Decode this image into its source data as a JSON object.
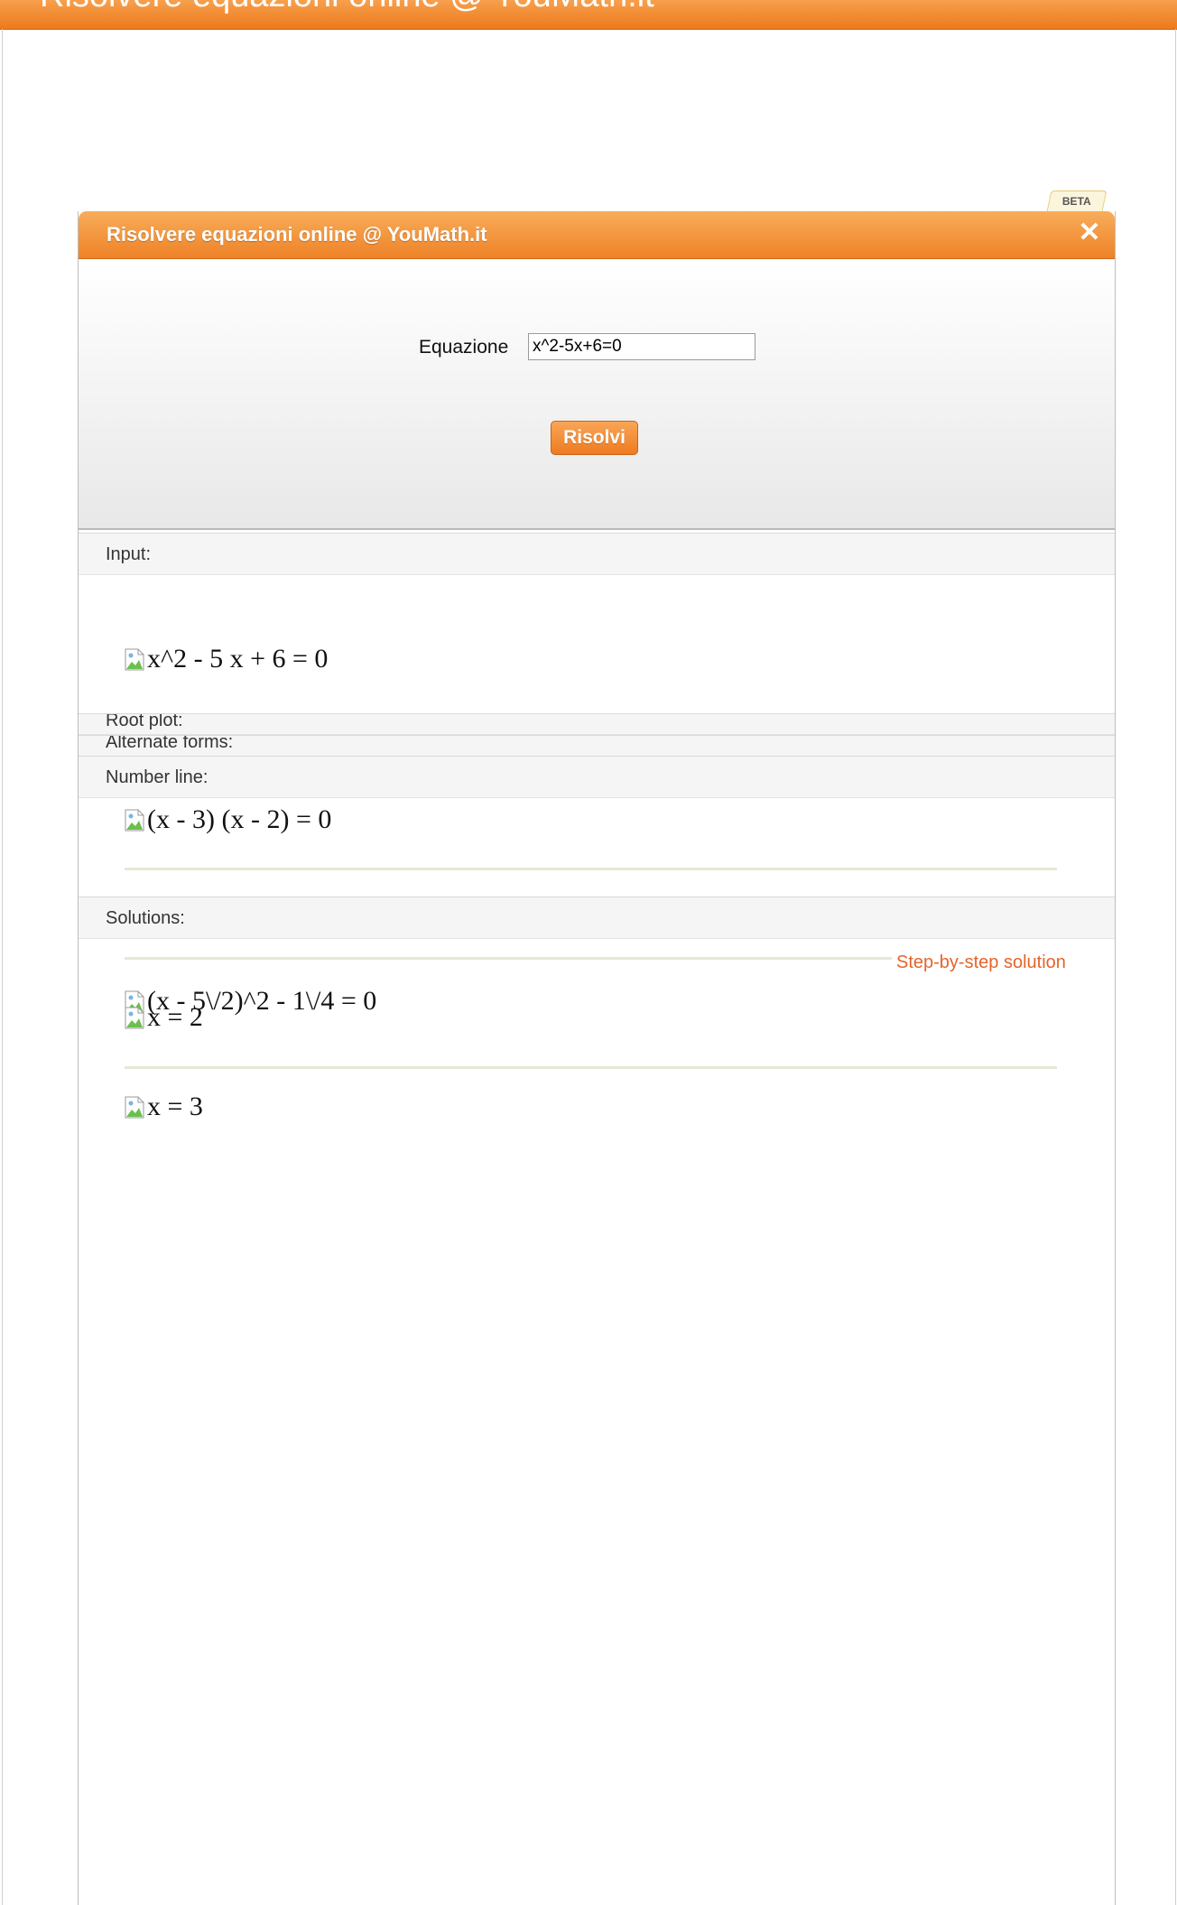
{
  "page": {
    "top_bar_title": "Risolvere equazioni online @ YouMath.it"
  },
  "widget": {
    "beta_badge": "BETA",
    "title": "Risolvere equazioni online @ YouMath.it",
    "close_glyph": "✕",
    "form": {
      "equation_label": "Equazione",
      "equation_value": "x^2-5x+6=0",
      "solve_label": "Risolvi"
    }
  },
  "pods": {
    "input": {
      "title": "Input:",
      "expression": "x^2 - 5 x + 6 = 0"
    },
    "root_plot": {
      "title": "Root plot:"
    },
    "alternate_forms": {
      "title": "Alternate forms:"
    },
    "number_line": {
      "title": "Number line:",
      "factored": "(x - 3) (x - 2) = 0"
    },
    "solutions": {
      "title": "Solutions:",
      "step_by_step_link": "Step-by-step solution",
      "alternate_form_overlap": "(x - 5\\/2)^2 - 1\\/4 = 0",
      "solution_1": "x = 2",
      "solution_2": "x = 3"
    }
  },
  "icons": {
    "close": "close-icon",
    "broken_image": "broken-image-icon"
  },
  "colors": {
    "orange_header": "#ee8227",
    "link_orange": "#e4642a",
    "separator": "#e8e8d4"
  }
}
